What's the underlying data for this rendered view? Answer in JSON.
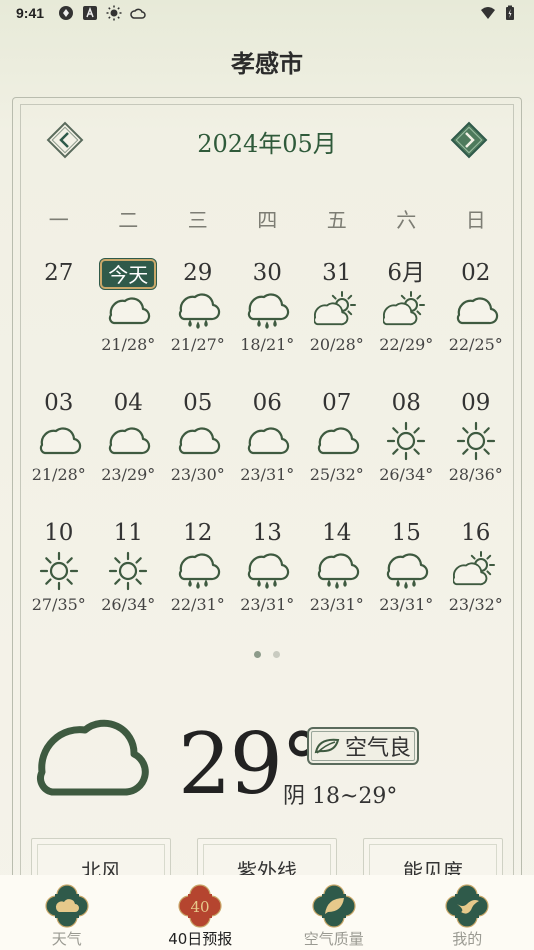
{
  "status_bar": {
    "time": "9:41"
  },
  "header": {
    "city": "孝感市"
  },
  "calendar": {
    "month_title": "2024年05月",
    "weekdays": [
      "一",
      "二",
      "三",
      "四",
      "五",
      "六",
      "日"
    ],
    "today_label": "今天",
    "weeks": [
      [
        {
          "date": "27",
          "icon": "none",
          "range": ""
        },
        {
          "date": "今天",
          "icon": "cloud",
          "range": "21/28°",
          "today": true
        },
        {
          "date": "29",
          "icon": "rain",
          "range": "21/27°"
        },
        {
          "date": "30",
          "icon": "rain",
          "range": "18/21°"
        },
        {
          "date": "31",
          "icon": "partly-sunny",
          "range": "20/28°"
        },
        {
          "date": "6月",
          "icon": "partly-sunny",
          "range": "22/29°"
        },
        {
          "date": "02",
          "icon": "cloud",
          "range": "22/25°"
        }
      ],
      [
        {
          "date": "03",
          "icon": "cloud",
          "range": "21/28°"
        },
        {
          "date": "04",
          "icon": "cloud",
          "range": "23/29°"
        },
        {
          "date": "05",
          "icon": "cloud",
          "range": "23/30°"
        },
        {
          "date": "06",
          "icon": "cloud",
          "range": "23/31°"
        },
        {
          "date": "07",
          "icon": "cloud",
          "range": "25/32°"
        },
        {
          "date": "08",
          "icon": "sun",
          "range": "26/34°"
        },
        {
          "date": "09",
          "icon": "sun",
          "range": "28/36°"
        }
      ],
      [
        {
          "date": "10",
          "icon": "sun",
          "range": "27/35°"
        },
        {
          "date": "11",
          "icon": "sun",
          "range": "26/34°"
        },
        {
          "date": "12",
          "icon": "rain",
          "range": "22/31°"
        },
        {
          "date": "13",
          "icon": "rain",
          "range": "23/31°"
        },
        {
          "date": "14",
          "icon": "rain",
          "range": "23/31°"
        },
        {
          "date": "15",
          "icon": "rain",
          "range": "23/31°"
        },
        {
          "date": "16",
          "icon": "partly-sunny",
          "range": "23/32°"
        }
      ]
    ],
    "pages": 2,
    "active_page": 1
  },
  "current": {
    "temperature": "29°",
    "air_quality": "空气良",
    "condition": "阴 18~29°"
  },
  "info_cards": [
    {
      "label": "北风"
    },
    {
      "label": "紫外线"
    },
    {
      "label": "能见度"
    }
  ],
  "tabs": [
    {
      "label": "天气",
      "icon": "weather-tab-icon",
      "active": false
    },
    {
      "label": "40日预报",
      "icon": "forecast-40-tab-icon",
      "badge": "40",
      "active": true
    },
    {
      "label": "空气质量",
      "icon": "air-quality-tab-icon",
      "active": false
    },
    {
      "label": "我的",
      "icon": "profile-tab-icon",
      "active": false
    }
  ],
  "colors": {
    "accent_green": "#2f5a4a",
    "title_green": "#2f5a3a",
    "active_tab_red": "#b5452f",
    "gold": "#c9a86a"
  }
}
